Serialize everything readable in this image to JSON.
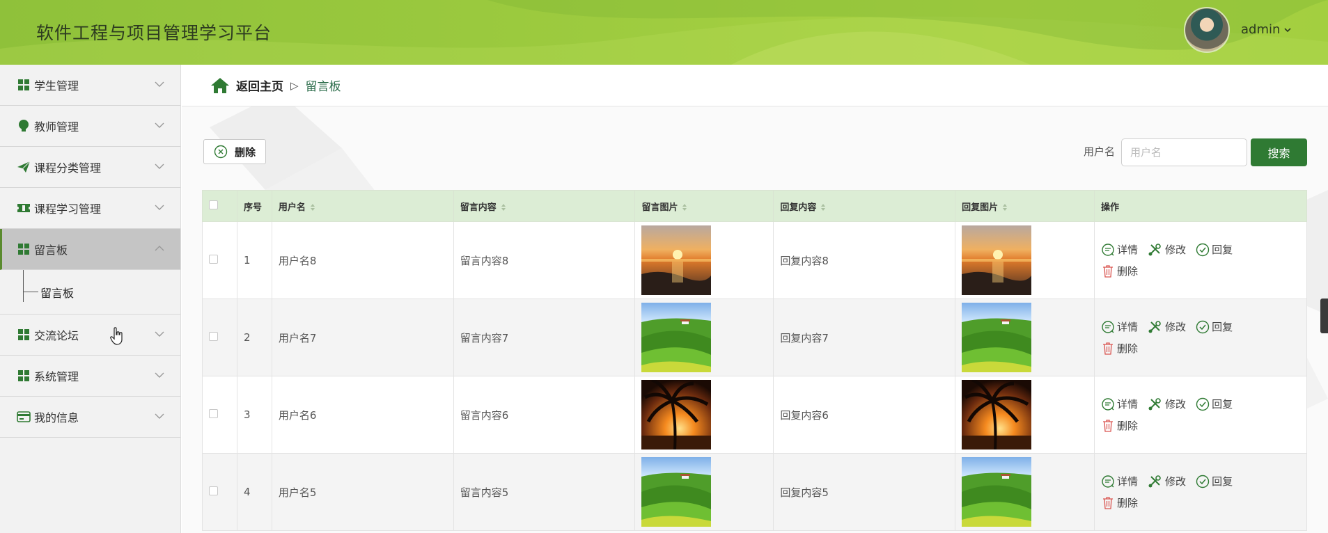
{
  "header": {
    "title": "软件工程与项目管理学习平台",
    "user": "admin"
  },
  "sidebar": {
    "items": [
      {
        "label": "学生管理",
        "icon": "grid-icon"
      },
      {
        "label": "教师管理",
        "icon": "bulb-icon"
      },
      {
        "label": "课程分类管理",
        "icon": "paper-plane-icon"
      },
      {
        "label": "课程学习管理",
        "icon": "ticket-icon"
      },
      {
        "label": "留言板",
        "icon": "grid-icon",
        "active": true
      },
      {
        "label": "交流论坛",
        "icon": "grid-icon"
      },
      {
        "label": "系统管理",
        "icon": "grid-icon"
      },
      {
        "label": "我的信息",
        "icon": "card-icon"
      }
    ],
    "sub_item": "留言板"
  },
  "breadcrumb": {
    "home": "返回主页",
    "separator": "▷",
    "current": "留言板"
  },
  "toolbar": {
    "delete_label": "删除",
    "search_label": "用户名",
    "search_placeholder": "用户名",
    "search_button": "搜索"
  },
  "table": {
    "columns": [
      "序号",
      "用户名",
      "留言内容",
      "留言图片",
      "回复内容",
      "回复图片",
      "操作"
    ],
    "actions": {
      "detail": "详情",
      "edit": "修改",
      "reply": "回复",
      "delete": "删除"
    },
    "rows": [
      {
        "index": "1",
        "username": "用户名8",
        "message": "留言内容8",
        "reply": "回复内容8",
        "image": "sunset-beach"
      },
      {
        "index": "2",
        "username": "用户名7",
        "message": "留言内容7",
        "reply": "回复内容7",
        "image": "green-hills"
      },
      {
        "index": "3",
        "username": "用户名6",
        "message": "留言内容6",
        "reply": "回复内容6",
        "image": "palm-sunset"
      },
      {
        "index": "4",
        "username": "用户名5",
        "message": "留言内容5",
        "reply": "回复内容5",
        "image": "green-hills"
      }
    ]
  },
  "colors": {
    "accent": "#2f7a33",
    "header_green": "#9dcb3f",
    "table_header": "#dcedd5"
  }
}
